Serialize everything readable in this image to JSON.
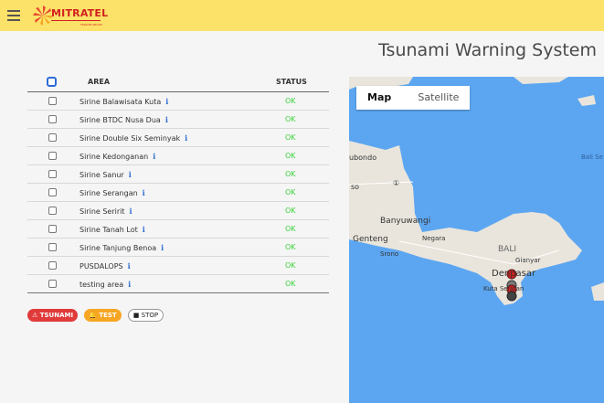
{
  "header": {
    "menu_icon": "hamburger-icon",
    "logo_text": "MITRATEL",
    "logo_tagline": "TELKOM GROUP",
    "title": "Tsunami Warning System"
  },
  "table": {
    "col_area": "AREA",
    "col_status": "STATUS",
    "rows": [
      {
        "name": "Sirine Balawisata Kuta",
        "info": "i",
        "status": "OK"
      },
      {
        "name": "Sirine BTDC Nusa Dua",
        "info": "i",
        "status": "OK"
      },
      {
        "name": "Sirine Double Six Seminyak",
        "info": "i",
        "status": "OK"
      },
      {
        "name": "Sirine Kedonganan",
        "info": "i",
        "status": "OK"
      },
      {
        "name": "Sirine Sanur",
        "info": "i",
        "status": "OK"
      },
      {
        "name": "Sirine Serangan",
        "info": "i",
        "status": "OK"
      },
      {
        "name": "Sirine Seririt",
        "info": "i",
        "status": "OK"
      },
      {
        "name": "Sirine Tanah Lot",
        "info": "i",
        "status": "OK"
      },
      {
        "name": "Sirine Tanjung Benoa",
        "info": "i",
        "status": "OK"
      },
      {
        "name": "PUSDALOPS",
        "info": "i",
        "status": "OK"
      },
      {
        "name": "testing area",
        "info": "i",
        "status": "OK"
      }
    ]
  },
  "actions": {
    "tsunami": "TSUNAMI",
    "test": "TEST",
    "stop": "STOP"
  },
  "map": {
    "type_map": "Map",
    "type_satellite": "Satellite",
    "labels": {
      "bondo": "ubondo",
      "so": "so",
      "road": "①",
      "banyuwangi": "Banyuwangi",
      "genteng": "Genteng",
      "negara": "Negara",
      "srono": "Srono",
      "bali": "BALI",
      "gianyar": "Gianyar",
      "denpasar": "Denpasar",
      "kuta": "Kuta Selatan",
      "bali_sea": "Bali Se"
    },
    "colors": {
      "sea": "#5ca6f1",
      "land": "#e9e5dc",
      "marker": "#d61f1f"
    }
  }
}
